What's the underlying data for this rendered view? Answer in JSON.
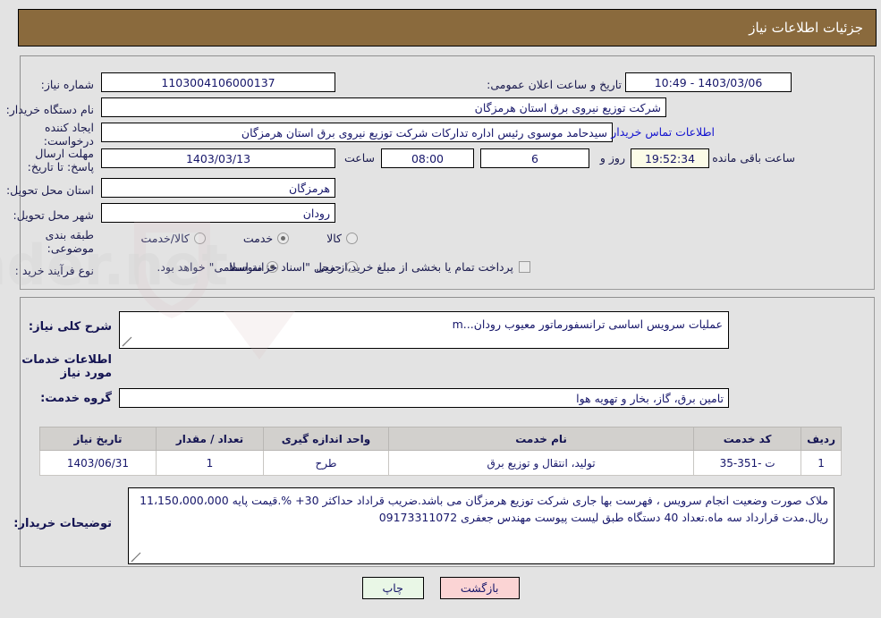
{
  "header": {
    "title": "جزئیات اطلاعات نیاز"
  },
  "form": {
    "need_number_label": "شماره نیاز:",
    "need_number_value": "1103004106000137",
    "announce_datetime_label": "تاریخ و ساعت اعلان عمومی:",
    "announce_datetime_value": "1403/03/06 - 10:49",
    "buyer_org_label": "نام دستگاه خریدار:",
    "buyer_org_value": "شرکت توزیع نیروی برق استان هرمزگان",
    "requester_label": "ایجاد کننده درخواست:",
    "requester_value": "سیدحامد موسوی رئیس اداره تدارکات شرکت توزیع نیروی برق استان هرمزگان",
    "contact_link": "اطلاعات تماس خریدار",
    "deadline_label": "مهلت ارسال پاسخ: تا تاریخ:",
    "deadline_date": "1403/03/13",
    "hour_label": "ساعت",
    "deadline_time": "08:00",
    "days_value": "6",
    "days_label": "روز و",
    "countdown_value": "19:52:34",
    "remaining_label": "ساعت باقی مانده",
    "province_label": "استان محل تحویل:",
    "province_value": "هرمزگان",
    "city_label": "شهر محل تحویل:",
    "city_value": "رودان",
    "classification_label": "طبقه بندی موضوعی:",
    "classification_options": [
      {
        "label": "کالا",
        "selected": false
      },
      {
        "label": "خدمت",
        "selected": true
      },
      {
        "label": "کالا/خدمت",
        "selected": false
      }
    ],
    "process_label": "نوع فرآیند خرید :",
    "process_options": [
      {
        "label": "جزیی",
        "selected": false
      },
      {
        "label": "متوسط",
        "selected": true
      }
    ],
    "treasury_checkbox_label": "پرداخت تمام یا بخشی از مبلغ خرید،از محل \"اسناد خزانه اسلامی\" خواهد بود.",
    "treasury_checked": false
  },
  "description": {
    "general_need_label": "شرح کلی نیاز:",
    "general_need_value": "عملیات سرویس اساسی ترانسفورماتور معیوب رودان...m",
    "services_section_title": "اطلاعات خدمات مورد نیاز",
    "service_group_label": "گروه خدمت:",
    "service_group_value": "تامین برق، گاز، بخار و تهویه هوا"
  },
  "table": {
    "columns": [
      "ردیف",
      "کد خدمت",
      "نام خدمت",
      "واحد اندازه گیری",
      "تعداد / مقدار",
      "تاریخ نیاز"
    ],
    "rows": [
      {
        "row_no": "1",
        "service_code": "ت -351-35",
        "service_name": "تولید، انتقال و توزیع برق",
        "unit": "طرح",
        "quantity": "1",
        "need_date": "1403/06/31"
      }
    ]
  },
  "buyer_notes": {
    "label": "توضیحات خریدار:",
    "value": "ملاک صورت وضعیت انجام سرویس ، فهرست بها جاری شرکت توزیع هرمزگان می باشد.ضریب قراداد حداکثر 30+ %.قیمت پایه 11،150،000،000 ریال.مدت قرارداد سه ماه.تعداد 40 دستگاه طبق لیست پیوست مهندس جعفری 09173311072"
  },
  "buttons": {
    "print": "چاپ",
    "back": "بازگشت"
  },
  "colors": {
    "header_bar": "#8a6a3d",
    "page_bg": "#e3e3e3",
    "link": "#1313cf",
    "label_text": "#1a1a4e",
    "table_header_bg": "#d2d0cd",
    "countdown_bg": "#fbfbe7",
    "print_btn_bg": "#e9f7e6",
    "back_btn_bg": "#fbd4d4"
  }
}
